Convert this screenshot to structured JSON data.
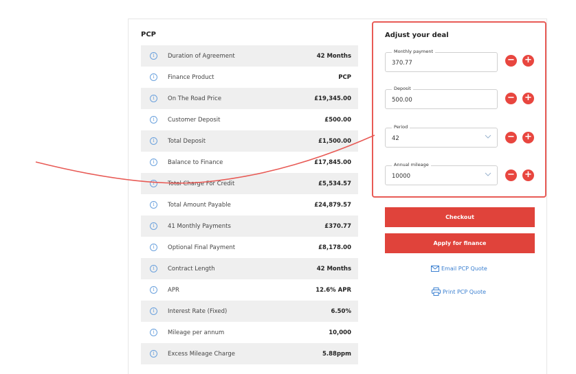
{
  "pcp": {
    "title": "PCP",
    "rows": [
      {
        "label": "Duration of Agreement",
        "value": "42 Months",
        "icon": "info-icon"
      },
      {
        "label": "Finance Product",
        "value": "PCP",
        "icon": "info-icon"
      },
      {
        "label": "On The Road Price",
        "value": "£19,345.00",
        "icon": "info-icon"
      },
      {
        "label": "Customer Deposit",
        "value": "£500.00",
        "icon": "info-icon"
      },
      {
        "label": "Total Deposit",
        "value": "£1,500.00",
        "icon": "info-icon"
      },
      {
        "label": "Balance to Finance",
        "value": "£17,845.00",
        "icon": "info-icon"
      },
      {
        "label": "Total Charge For Credit",
        "value": "£5,534.57",
        "icon": "info-icon"
      },
      {
        "label": "Total Amount Payable",
        "value": "£24,879.57",
        "icon": "info-icon"
      },
      {
        "label": "41 Monthly Payments",
        "value": "£370.77",
        "icon": "info-icon"
      },
      {
        "label": "Optional Final Payment",
        "value": "£8,178.00",
        "icon": "info-icon"
      },
      {
        "label": "Contract Length",
        "value": "42 Months",
        "icon": "info-icon"
      },
      {
        "label": "APR",
        "value": "12.6% APR",
        "icon": "info-icon"
      },
      {
        "label": "Interest Rate (Fixed)",
        "value": "6.50%",
        "icon": "info-icon"
      },
      {
        "label": "Mileage per annum",
        "value": "10,000",
        "icon": "info-icon"
      },
      {
        "label": "Excess Mileage Charge",
        "value": "5.88ppm",
        "icon": "info-icon"
      }
    ],
    "info_glyph": "i"
  },
  "adjust": {
    "title": "Adjust your deal",
    "monthly_payment": {
      "label": "Monthly payment",
      "value": "370.77"
    },
    "deposit": {
      "label": "Deposit",
      "value": "500.00"
    },
    "period": {
      "label": "Period",
      "value": "42"
    },
    "annual_mileage": {
      "label": "Annual mileage",
      "value": "10000"
    },
    "minus_glyph": "−",
    "plus_glyph": "+"
  },
  "actions": {
    "checkout": "Checkout",
    "apply": "Apply for finance",
    "email_quote": "Email PCP Quote",
    "print_quote": "Print PCP Quote"
  },
  "colors": {
    "accent_red": "#e0433b",
    "highlight_border": "#e85a55",
    "link_blue": "#3a7fd0",
    "info_blue": "#6aa1dd",
    "row_shade": "#efefef"
  }
}
